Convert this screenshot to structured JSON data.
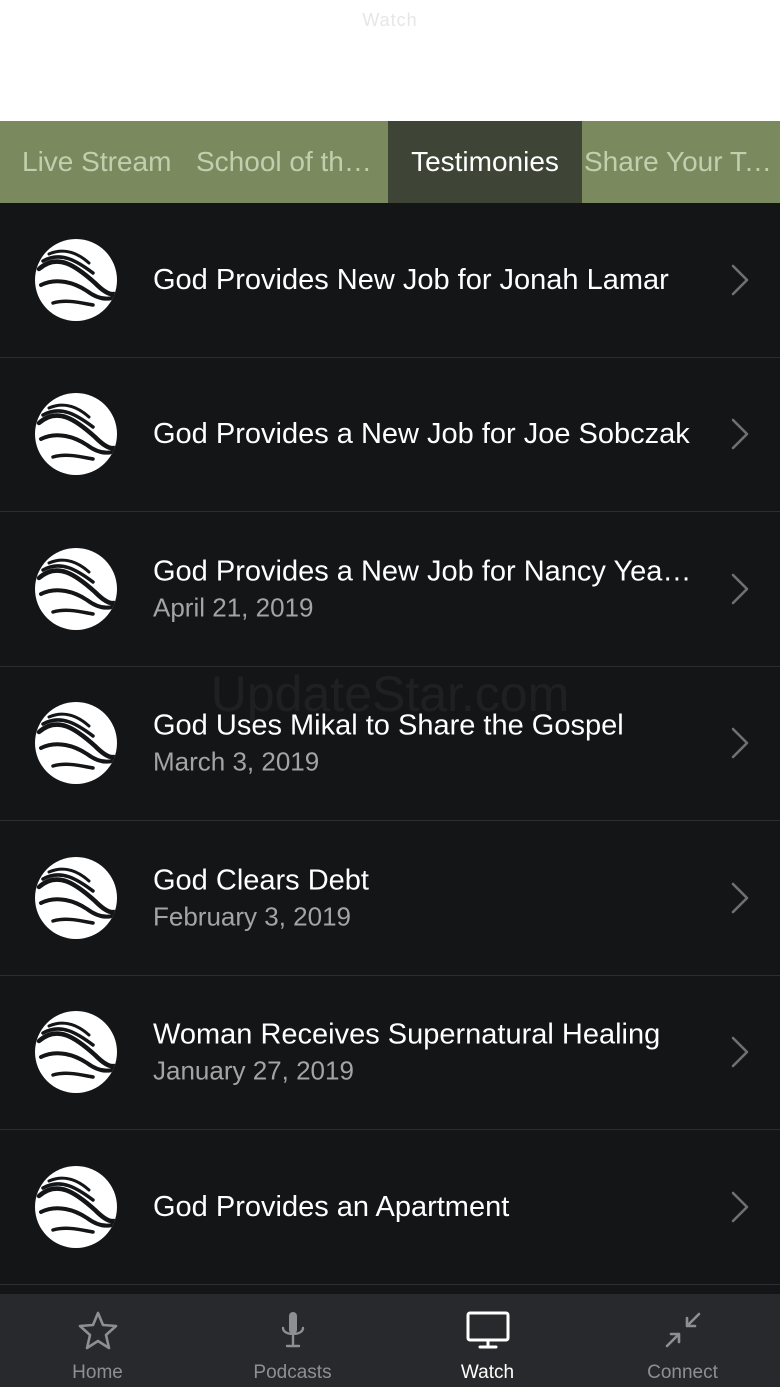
{
  "header": {
    "title": "Watch"
  },
  "tabs": [
    {
      "label": "Live Stream",
      "active": false
    },
    {
      "label": "School of the Spirit",
      "active": false
    },
    {
      "label": "Testimonies",
      "active": true
    },
    {
      "label": "Share Your Testimony",
      "active": false
    }
  ],
  "list": {
    "items": [
      {
        "title": "God Provides New Job for Jonah Lamar",
        "date": ""
      },
      {
        "title": "God Provides a New Job for Joe Sobczak",
        "date": ""
      },
      {
        "title": "God Provides a New Job for Nancy Yeager",
        "date": "April 21, 2019"
      },
      {
        "title": "God Uses Mikal to Share the Gospel",
        "date": "March 3, 2019"
      },
      {
        "title": "God Clears Debt",
        "date": "February 3, 2019"
      },
      {
        "title": "Woman Receives Supernatural Healing",
        "date": "January 27, 2019"
      },
      {
        "title": "God Provides an Apartment",
        "date": ""
      }
    ]
  },
  "watermark": "UpdateStar.com",
  "tabbar": {
    "items": [
      {
        "label": "Home",
        "icon": "star-icon",
        "active": false
      },
      {
        "label": "Podcasts",
        "icon": "microphone-icon",
        "active": false
      },
      {
        "label": "Watch",
        "icon": "tv-icon",
        "active": true
      },
      {
        "label": "Connect",
        "icon": "collapse-arrows-icon",
        "active": false
      }
    ]
  },
  "colors": {
    "tab_bar_bg": "#7a8a5e",
    "tab_active_bg": "#3e4537",
    "list_bg": "#141517",
    "bottom_bar_bg": "#28292c"
  }
}
